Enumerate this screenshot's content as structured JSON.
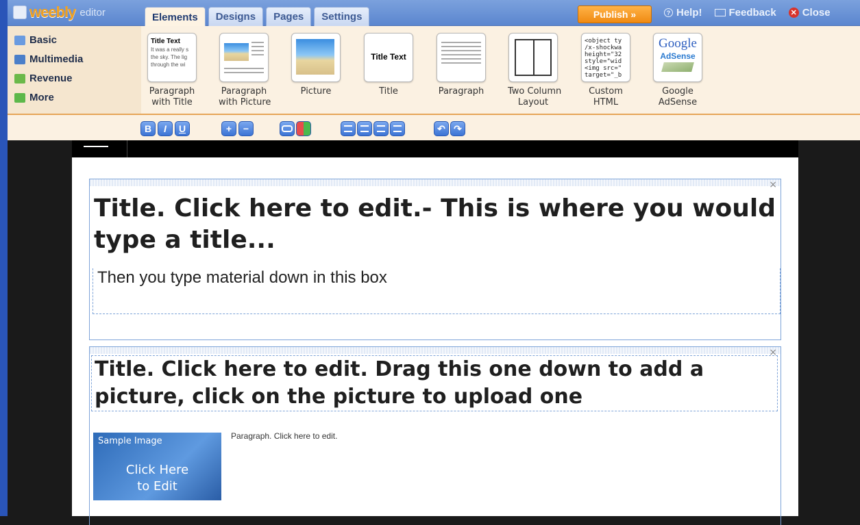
{
  "app": {
    "logo_text": "weebly",
    "logo_sub": "editor"
  },
  "tabs": [
    {
      "label": "Elements",
      "active": true
    },
    {
      "label": "Designs",
      "active": false
    },
    {
      "label": "Pages",
      "active": false
    },
    {
      "label": "Settings",
      "active": false
    }
  ],
  "publish_label": "Publish »",
  "top_links": {
    "help": "Help!",
    "feedback": "Feedback",
    "close": "Close"
  },
  "categories": [
    {
      "label": "Basic",
      "icon": "basic-icon"
    },
    {
      "label": "Multimedia",
      "icon": "multimedia-icon"
    },
    {
      "label": "Revenue",
      "icon": "revenue-icon"
    },
    {
      "label": "More",
      "icon": "more-icon"
    }
  ],
  "elements": [
    {
      "label1": "Paragraph",
      "label2": "with Title",
      "thumb_title": "Title Text",
      "thumb_text": "It was a really s the sky.  The lig through the wi"
    },
    {
      "label1": "Paragraph",
      "label2": "with Picture"
    },
    {
      "label1": "Picture",
      "label2": ""
    },
    {
      "label1": "Title",
      "label2": "",
      "thumb_title": "Title Text"
    },
    {
      "label1": "Paragraph",
      "label2": ""
    },
    {
      "label1": "Two Column",
      "label2": "Layout"
    },
    {
      "label1": "Custom",
      "label2": "HTML",
      "thumb_code": "<object ty\n/x-shockwa\nheight=\"32\nstyle=\"wid\n<img src=\"\ntarget=\"_b"
    },
    {
      "label1": "Google",
      "label2": "AdSense",
      "thumb_google": "Google",
      "thumb_adsense": "AdSense"
    }
  ],
  "format_buttons": [
    "B",
    "I",
    "U",
    "+",
    "−"
  ],
  "content": {
    "block1_title": "Title. Click here to edit.- This is where you would type a title...",
    "block1_para": "Then you type material down in this box",
    "block2_title": "Title. Click here to edit. Drag this one down to add a picture, click on the picture to upload one",
    "block2_para": "Paragraph. Click here to edit.",
    "sample_label": "Sample Image",
    "sample_cta1": "Click Here",
    "sample_cta2": "to Edit",
    "close_glyph": "×"
  }
}
